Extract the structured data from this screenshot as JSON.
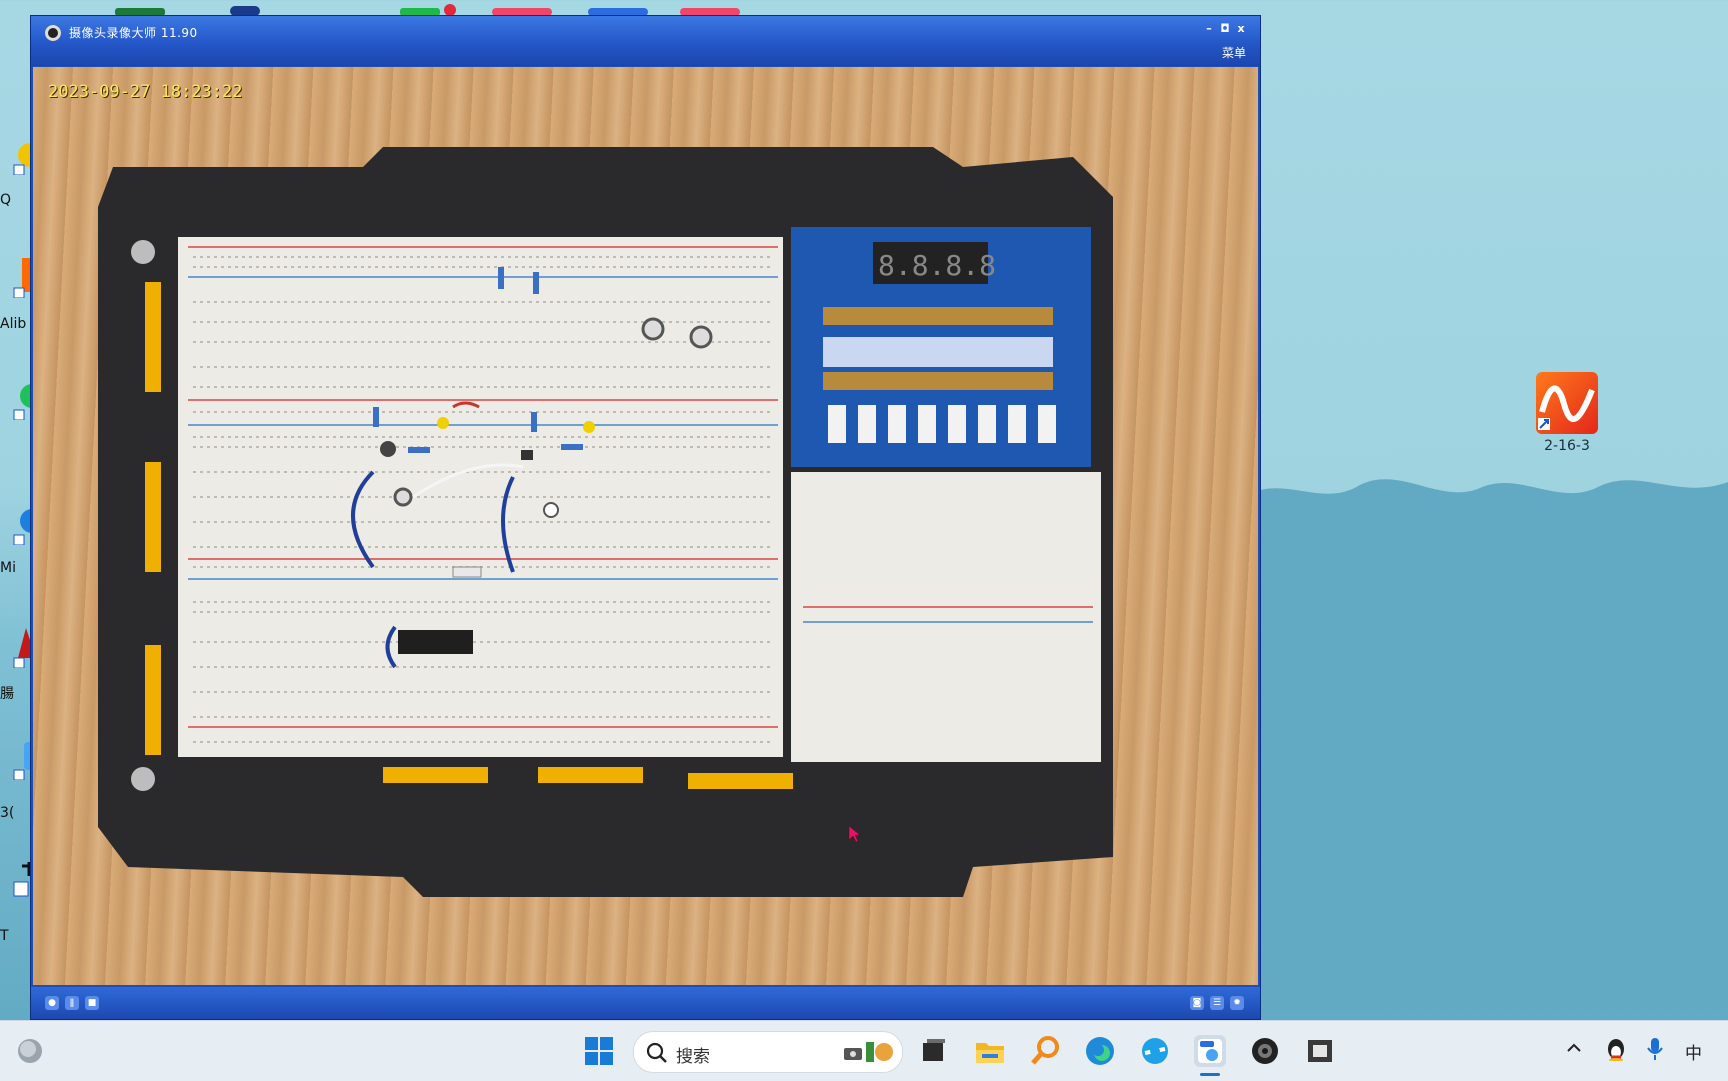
{
  "window": {
    "title": "摄像头录像大师  11.90",
    "menu_label": "菜单",
    "min_glyph": "–",
    "max_glyph": "◘",
    "close_glyph": "x"
  },
  "video": {
    "timestamp": "2023-09-27 18:23:22"
  },
  "controls": {
    "record_glyph": "●",
    "pause_glyph": "ǁ",
    "stop_glyph": "■",
    "snapshot_glyph": "◙",
    "list_glyph": "☰",
    "settings_glyph": "✹"
  },
  "desktop": {
    "edge_labels": [
      "Q",
      "Alib",
      "Mi",
      "腸",
      "3(",
      "T"
    ],
    "shortcut_label": "2-16-3"
  },
  "taskbar": {
    "search_placeholder": "搜索",
    "ime_label": "中"
  },
  "colors": {
    "window_blue": "#2457c8",
    "timestamp_yellow": "#ffe94a",
    "shortcut_orange": "#ff7a1a"
  }
}
